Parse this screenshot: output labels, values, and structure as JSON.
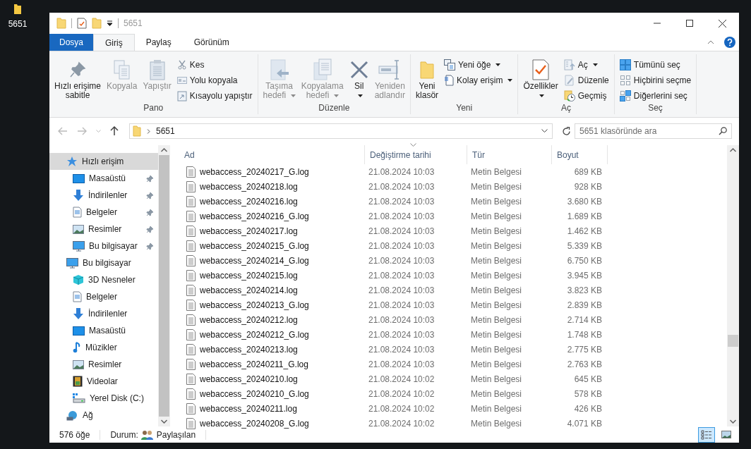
{
  "desktop_icon": {
    "label": "5651"
  },
  "window": {
    "title": "5651"
  },
  "ribbon_tabs": [
    {
      "label": "Dosya",
      "kind": "file",
      "selected": false
    },
    {
      "label": "Giriş",
      "kind": "tab",
      "selected": true
    },
    {
      "label": "Paylaş",
      "kind": "tab",
      "selected": false
    },
    {
      "label": "Görünüm",
      "kind": "tab",
      "selected": false
    }
  ],
  "ribbon_groups": [
    {
      "label": "Pano",
      "items": [
        {
          "kind": "large",
          "lines": [
            "Hızlı erişime",
            "sabitle"
          ],
          "disabled": false,
          "dropdown": false
        },
        {
          "kind": "large",
          "lines": [
            "Kopyala"
          ],
          "disabled": true,
          "dropdown": false
        },
        {
          "kind": "large",
          "lines": [
            "Yapıştır"
          ],
          "disabled": true,
          "dropdown": false
        },
        {
          "kind": "small",
          "lines": [
            "Kes"
          ],
          "disabled": true,
          "dropdown": false
        },
        {
          "kind": "small",
          "lines": [
            "Yolu kopyala"
          ],
          "disabled": true,
          "dropdown": false
        },
        {
          "kind": "small",
          "lines": [
            "Kısayolu yapıştır"
          ],
          "disabled": true,
          "dropdown": false
        }
      ]
    },
    {
      "label": "Düzenle",
      "items": [
        {
          "kind": "large",
          "lines": [
            "Taşıma",
            "hedefi"
          ],
          "disabled": true,
          "dropdown": true
        },
        {
          "kind": "large",
          "lines": [
            "Kopyalama",
            "hedefi"
          ],
          "disabled": true,
          "dropdown": true
        },
        {
          "kind": "large",
          "lines": [
            "Sil"
          ],
          "disabled": false,
          "dropdown": true
        },
        {
          "kind": "large",
          "lines": [
            "Yeniden",
            "adlandır"
          ],
          "disabled": true,
          "dropdown": false
        }
      ]
    },
    {
      "label": "Yeni",
      "items": [
        {
          "kind": "large",
          "lines": [
            "Yeni",
            "klasör"
          ],
          "disabled": false,
          "dropdown": false
        },
        {
          "kind": "small",
          "lines": [
            "Yeni öğe"
          ],
          "disabled": false,
          "dropdown": true
        },
        {
          "kind": "small",
          "lines": [
            "Kolay erişim"
          ],
          "disabled": false,
          "dropdown": true
        }
      ]
    },
    {
      "label": "Aç",
      "items": [
        {
          "kind": "large",
          "lines": [
            "Özellikler"
          ],
          "disabled": false,
          "dropdown": true
        },
        {
          "kind": "small",
          "lines": [
            "Aç"
          ],
          "disabled": true,
          "dropdown": true
        },
        {
          "kind": "small",
          "lines": [
            "Düzenle"
          ],
          "disabled": true,
          "dropdown": false
        },
        {
          "kind": "small",
          "lines": [
            "Geçmiş"
          ],
          "disabled": false,
          "dropdown": false
        }
      ]
    },
    {
      "label": "Seç",
      "items": [
        {
          "kind": "small",
          "lines": [
            "Tümünü seç"
          ],
          "disabled": false,
          "dropdown": false
        },
        {
          "kind": "small",
          "lines": [
            "Hiçbirini seçme"
          ],
          "disabled": false,
          "dropdown": false
        },
        {
          "kind": "small",
          "lines": [
            "Diğerlerini seç"
          ],
          "disabled": false,
          "dropdown": false
        }
      ]
    }
  ],
  "address_bar": {
    "path": "5651"
  },
  "search": {
    "placeholder": "5651 klasöründe ara"
  },
  "sidebar": {
    "items": [
      {
        "label": "Hızlı erişim",
        "selected": true,
        "children": [
          {
            "label": "Masaüstü",
            "pinned": true,
            "selected": false
          },
          {
            "label": "İndirilenler",
            "pinned": true,
            "selected": false
          },
          {
            "label": "Belgeler",
            "pinned": true,
            "selected": false
          },
          {
            "label": "Resimler",
            "pinned": true,
            "selected": false
          },
          {
            "label": "Bu bilgisayar",
            "pinned": true,
            "selected": false
          }
        ]
      },
      {
        "label": "Bu bilgisayar",
        "selected": false,
        "children": [
          {
            "label": "3D Nesneler",
            "pinned": false,
            "selected": false
          },
          {
            "label": "Belgeler",
            "pinned": false,
            "selected": false
          },
          {
            "label": "İndirilenler",
            "pinned": false,
            "selected": false
          },
          {
            "label": "Masaüstü",
            "pinned": false,
            "selected": false
          },
          {
            "label": "Müzikler",
            "pinned": false,
            "selected": false
          },
          {
            "label": "Resimler",
            "pinned": false,
            "selected": false
          },
          {
            "label": "Videolar",
            "pinned": false,
            "selected": false
          },
          {
            "label": "Yerel Disk (C:)",
            "pinned": false,
            "selected": false
          }
        ]
      },
      {
        "label": "Ağ",
        "selected": false
      }
    ]
  },
  "table": {
    "columns": [
      {
        "label": "Ad",
        "sorted": false
      },
      {
        "label": "Değiştirme tarihi",
        "sorted": true
      },
      {
        "label": "Tür",
        "sorted": false
      },
      {
        "label": "Boyut",
        "sorted": false
      }
    ],
    "rows": [
      [
        "webaccess_20240217_G.log",
        "21.08.2024 10:03",
        "Metin Belgesi",
        "689 KB"
      ],
      [
        "webaccess_20240218.log",
        "21.08.2024 10:03",
        "Metin Belgesi",
        "928 KB"
      ],
      [
        "webaccess_20240216.log",
        "21.08.2024 10:03",
        "Metin Belgesi",
        "3.680 KB"
      ],
      [
        "webaccess_20240216_G.log",
        "21.08.2024 10:03",
        "Metin Belgesi",
        "1.689 KB"
      ],
      [
        "webaccess_20240217.log",
        "21.08.2024 10:03",
        "Metin Belgesi",
        "1.462 KB"
      ],
      [
        "webaccess_20240215_G.log",
        "21.08.2024 10:03",
        "Metin Belgesi",
        "5.339 KB"
      ],
      [
        "webaccess_20240214_G.log",
        "21.08.2024 10:03",
        "Metin Belgesi",
        "6.750 KB"
      ],
      [
        "webaccess_20240215.log",
        "21.08.2024 10:03",
        "Metin Belgesi",
        "3.945 KB"
      ],
      [
        "webaccess_20240214.log",
        "21.08.2024 10:03",
        "Metin Belgesi",
        "3.823 KB"
      ],
      [
        "webaccess_20240213_G.log",
        "21.08.2024 10:03",
        "Metin Belgesi",
        "2.839 KB"
      ],
      [
        "webaccess_20240212.log",
        "21.08.2024 10:03",
        "Metin Belgesi",
        "2.714 KB"
      ],
      [
        "webaccess_20240212_G.log",
        "21.08.2024 10:03",
        "Metin Belgesi",
        "1.748 KB"
      ],
      [
        "webaccess_20240213.log",
        "21.08.2024 10:03",
        "Metin Belgesi",
        "2.775 KB"
      ],
      [
        "webaccess_20240211_G.log",
        "21.08.2024 10:03",
        "Metin Belgesi",
        "2.763 KB"
      ],
      [
        "webaccess_20240210.log",
        "21.08.2024 10:02",
        "Metin Belgesi",
        "645 KB"
      ],
      [
        "webaccess_20240210_G.log",
        "21.08.2024 10:02",
        "Metin Belgesi",
        "578 KB"
      ],
      [
        "webaccess_20240211.log",
        "21.08.2024 10:02",
        "Metin Belgesi",
        "426 KB"
      ],
      [
        "webaccess_20240208_G.log",
        "21.08.2024 10:02",
        "Metin Belgesi",
        "4.071 KB"
      ]
    ]
  },
  "status_bar": {
    "count": "576 öğe",
    "status_label": "Durum:",
    "status_value": "Paylaşılan"
  },
  "view_buttons": [
    {
      "kind": "details",
      "selected": true
    },
    {
      "kind": "large_icons",
      "selected": false
    }
  ]
}
